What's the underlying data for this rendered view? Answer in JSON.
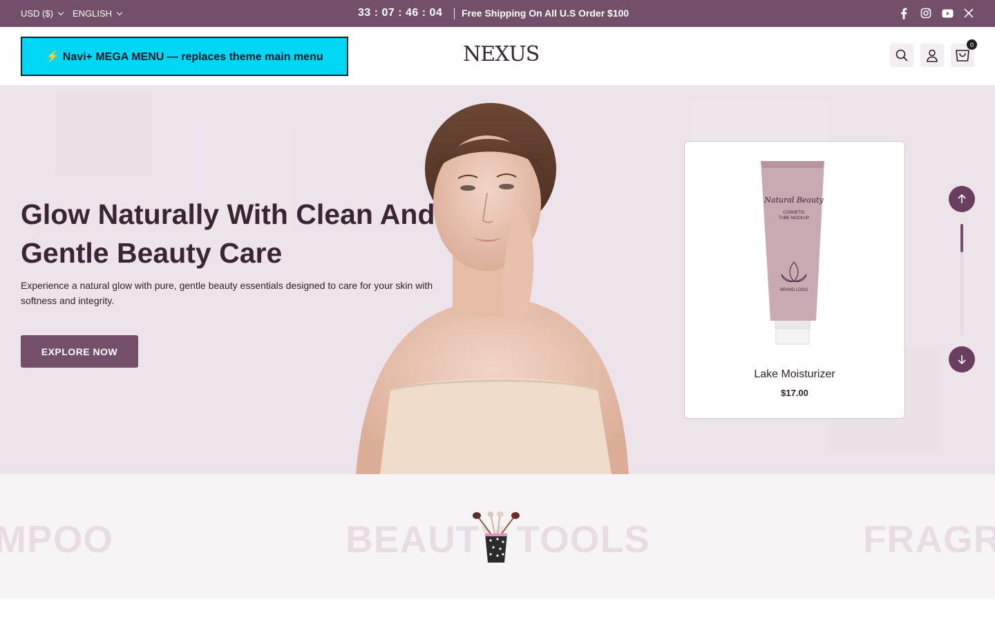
{
  "topbar": {
    "currency": "USD ($)",
    "language": "ENGLISH",
    "countdown": "33 : 07 : 46 : 04",
    "announcement": "Free Shipping On All U.S Order $100",
    "social_icons": [
      "facebook-icon",
      "instagram-icon",
      "youtube-icon",
      "x-icon"
    ]
  },
  "header": {
    "mega_menu_label": "⚡ Navi+ MEGA MENU — replaces theme main menu",
    "logo": "NEXUS",
    "cart_count": "0"
  },
  "hero": {
    "heading": "Glow Naturally With Clean And Gentle Beauty Care",
    "subtext": "Experience a natural glow with pure, gentle beauty essentials designed to care for your skin with softness and integrity.",
    "button_label": "EXPLORE NOW",
    "product": {
      "name": "Lake Moisturizer",
      "price": "$17.00",
      "tube_brand": "Natural Beauty",
      "tube_line1": "COSMETIC",
      "tube_line2": "TUBE MOCKUP",
      "tube_logo": "BRAND LOGO"
    },
    "slider_position": 0.25
  },
  "categories": {
    "items": [
      "MPOO",
      "BEAUTY TOOLS",
      "FRAGR"
    ]
  },
  "colors": {
    "brand": "#744f69",
    "hero_bg": "#ede3ea",
    "mega_menu_bg": "#00d7f5"
  }
}
